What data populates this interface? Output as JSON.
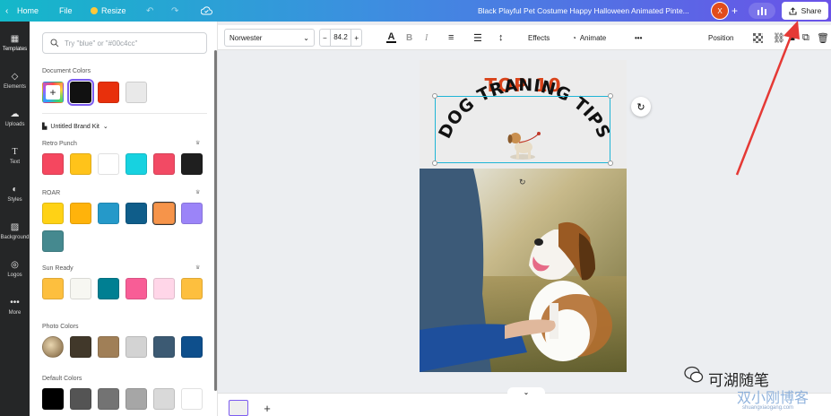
{
  "topbar": {
    "home": "Home",
    "file": "File",
    "resize": "Resize",
    "doc_title": "Black Playful Pet Costume Happy Halloween Animated Pinte...",
    "avatar_letter": "X",
    "share": "Share"
  },
  "rail": {
    "items": [
      {
        "label": "Templates",
        "icon": "templates-icon"
      },
      {
        "label": "Elements",
        "icon": "elements-icon"
      },
      {
        "label": "Uploads",
        "icon": "uploads-icon"
      },
      {
        "label": "Text",
        "icon": "text-icon"
      },
      {
        "label": "Styles",
        "icon": "styles-icon"
      },
      {
        "label": "Background",
        "icon": "background-icon"
      },
      {
        "label": "Logos",
        "icon": "logos-icon"
      },
      {
        "label": "More",
        "icon": "more-icon"
      }
    ]
  },
  "panel": {
    "search_placeholder": "Try \"blue\" or \"#00c4cc\"",
    "document_colors": {
      "title": "Document Colors",
      "colors": [
        "#111111",
        "#e8300c",
        "#e9e9e9"
      ]
    },
    "brand_kit": "Untitled Brand Kit",
    "palettes": [
      {
        "title": "Retro Punch",
        "colors": [
          "#f5475f",
          "#ffc31a",
          "#ffffff",
          "#17d2e0",
          "#f24a64",
          "#1f1f1f"
        ]
      },
      {
        "title": "ROAR",
        "colors": [
          "#ffd215",
          "#ffb30b",
          "#2599c9",
          "#0f5d8a",
          "#f6944a",
          "#9b84f8",
          "#45898f"
        ]
      },
      {
        "title": "Sun Ready",
        "colors": [
          "#fdbf3e",
          "#f7f7f2",
          "#007f92",
          "#f85d96",
          "#ffd6e8",
          "#fdbf3e"
        ]
      },
      {
        "title": "Photo Colors",
        "colors": [
          "#41382a",
          "#a07f57",
          "#d3d3d3",
          "#3c5a73",
          "#0e4f8c"
        ]
      },
      {
        "title": "Default Colors",
        "colors": [
          "#000000",
          "#545454",
          "#737373",
          "#a6a6a6",
          "#d9d9d9",
          "#ffffff"
        ]
      }
    ]
  },
  "toolbar": {
    "font": "Norwester",
    "size": "84.2",
    "effects": "Effects",
    "animate": "Animate",
    "position": "Position"
  },
  "design": {
    "top_text": "TOP 10",
    "curved_text": "DOG TRANING TIPS"
  },
  "watermark": {
    "name": "可湖随笔",
    "brand": "双小刚博客",
    "url": "shuangxiaogang.com"
  }
}
